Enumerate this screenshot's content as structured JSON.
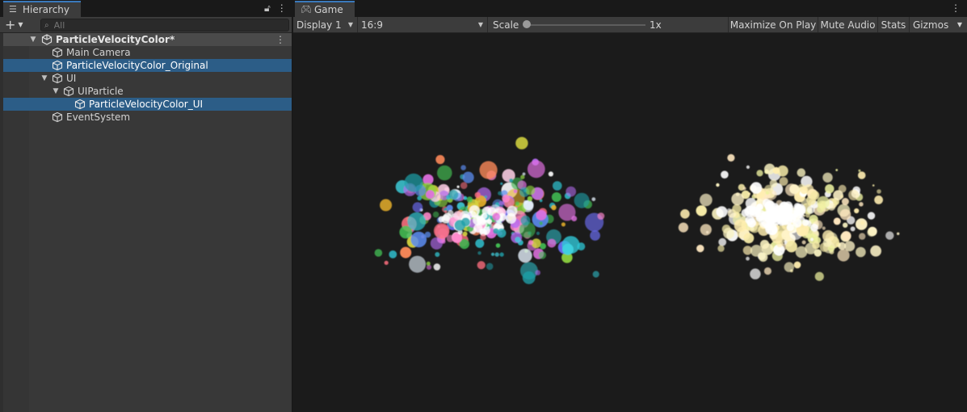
{
  "hierarchy": {
    "tab_label": "Hierarchy",
    "tab_icon": "list-icon",
    "search_placeholder": "All",
    "scene_name": "ParticleVelocityColor*",
    "items": [
      {
        "label": "Main Camera",
        "depth": 1,
        "selected": false,
        "expandable": false
      },
      {
        "label": "ParticleVelocityColor_Original",
        "depth": 1,
        "selected": true,
        "expandable": false
      },
      {
        "label": "UI",
        "depth": 1,
        "selected": false,
        "expandable": true
      },
      {
        "label": "UIParticle",
        "depth": 2,
        "selected": false,
        "expandable": true
      },
      {
        "label": "ParticleVelocityColor_UI",
        "depth": 3,
        "selected": true,
        "expandable": false
      },
      {
        "label": "EventSystem",
        "depth": 1,
        "selected": false,
        "expandable": false
      }
    ]
  },
  "game": {
    "tab_label": "Game",
    "tab_icon": "gamepad-icon",
    "display": "Display 1",
    "aspect": "16:9",
    "scale_label": "Scale",
    "scale_value": "1x",
    "buttons": {
      "maximize": "Maximize On Play",
      "mute": "Mute Audio",
      "stats": "Stats",
      "gizmos": "Gizmos"
    }
  },
  "colors": {
    "selection": "#2c5d87",
    "tab_accent": "#3a79bb",
    "panel_bg": "#383838",
    "viewport_bg": "#1b1b1b"
  }
}
